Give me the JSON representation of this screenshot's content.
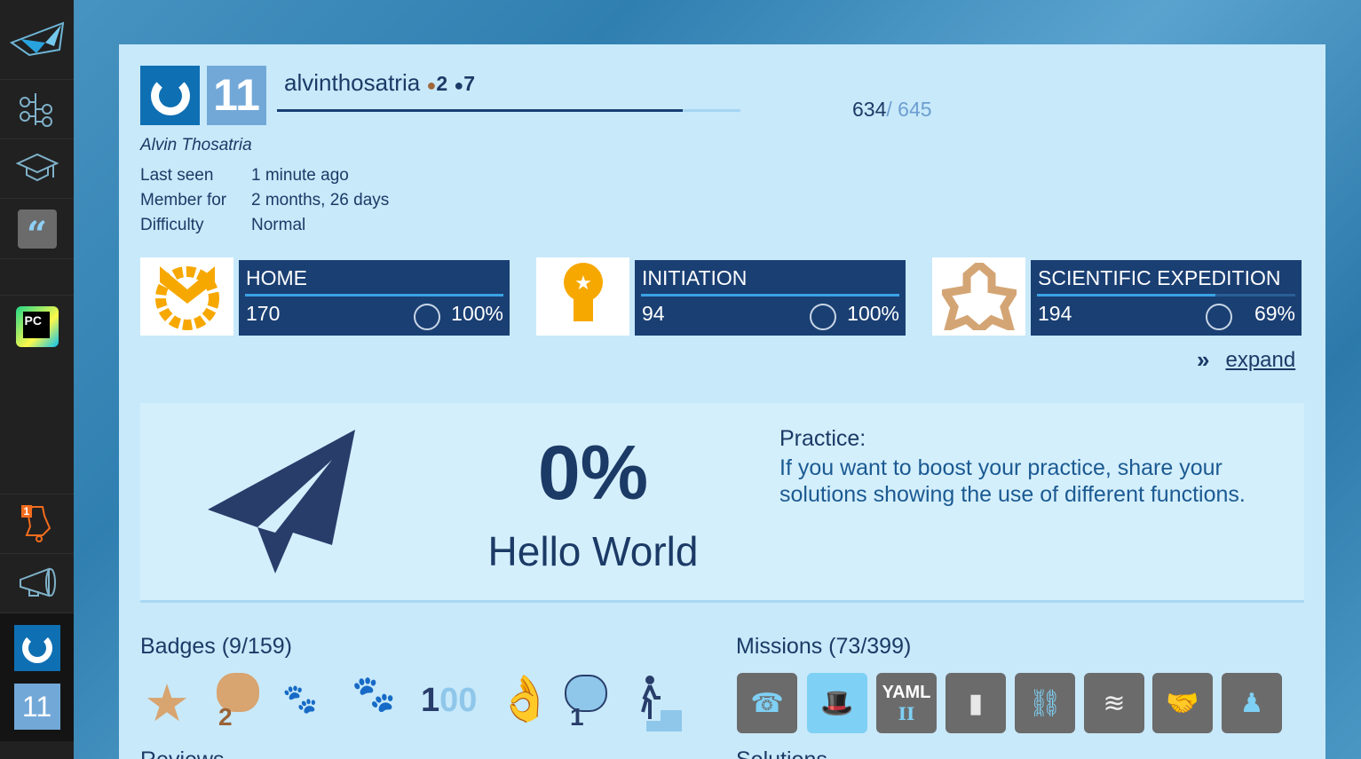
{
  "sidebar": {
    "items": [
      "logo",
      "tree",
      "graduation",
      "quotes",
      "pycharm",
      "notifications",
      "announcements",
      "avatar",
      "level"
    ],
    "notification_count": "1",
    "level": "11",
    "pc_label": "PC"
  },
  "profile": {
    "level": "11",
    "username": "alvinthosatria",
    "bronze_count": "2",
    "dark_count": "7",
    "full_name": "Alvin Thosatria",
    "xp_current": "634",
    "xp_total": "/ 645",
    "xp_progress": 0.983,
    "details": [
      {
        "label": "Last seen",
        "value": "1 minute ago"
      },
      {
        "label": "Member for",
        "value": "2 months, 26 days"
      },
      {
        "label": "Difficulty",
        "value": "Normal"
      }
    ]
  },
  "stations": [
    {
      "name": "HOME",
      "count": "170",
      "percent": "100%",
      "progress": 1.0,
      "color": "#f7a800"
    },
    {
      "name": "INITIATION",
      "count": "94",
      "percent": "100%",
      "progress": 1.0,
      "color": "#f7a800"
    },
    {
      "name": "SCIENTIFIC EXPEDITION",
      "count": "194",
      "percent": "69%",
      "progress": 0.69,
      "color": "#d4a574"
    }
  ],
  "expand_label": "expand",
  "practice": {
    "percent": "0%",
    "rank": "Hello World",
    "title": "Practice:",
    "text": "If you want to boost your practice, share your solutions showing the use of different functions."
  },
  "badges": {
    "title": "Badges (9/159)",
    "hundred": "1",
    "hundred_suffix": "00",
    "brain_2": "2",
    "brain_1": "1"
  },
  "missions": {
    "title": "Missions (73/399)",
    "yaml": "YAML",
    "yaml_sub": "II"
  },
  "bottom": {
    "left": "Reviews",
    "right": "Solutions"
  }
}
